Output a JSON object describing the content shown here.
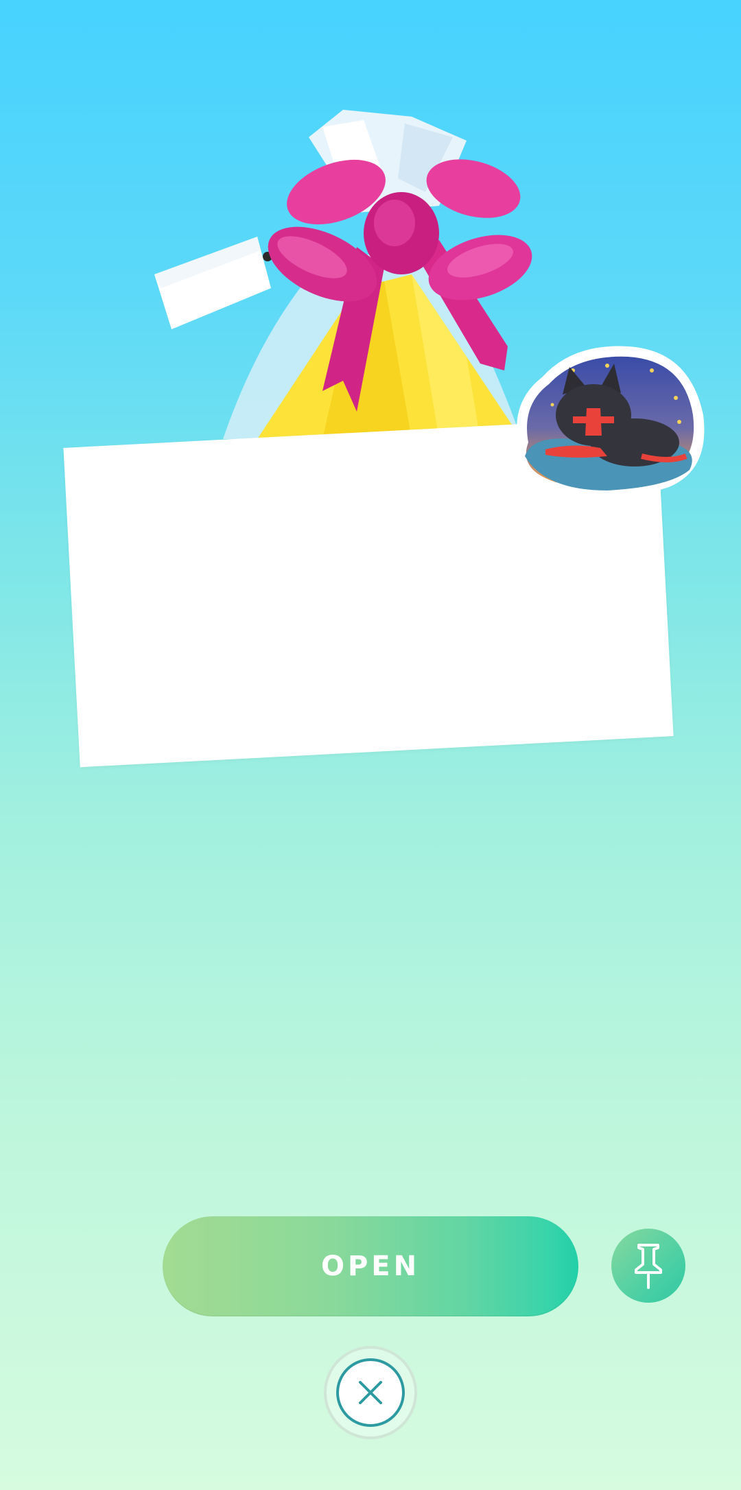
{
  "screen": {
    "name": "gift-open-screen",
    "background_top": "#47d2fe",
    "background_bottom": "#d6fbdf"
  },
  "gift": {
    "icon": "gift-bag-icon",
    "bow_color": "#e9339a",
    "bag_color": "#fde23a"
  },
  "note_card": {
    "text": ""
  },
  "sticker": {
    "icon": "sleeping-cat-sticker"
  },
  "actions": {
    "open_label": "OPEN",
    "pin_icon": "pin-icon",
    "close_icon": "close-icon",
    "accent": "#22cfa8"
  }
}
